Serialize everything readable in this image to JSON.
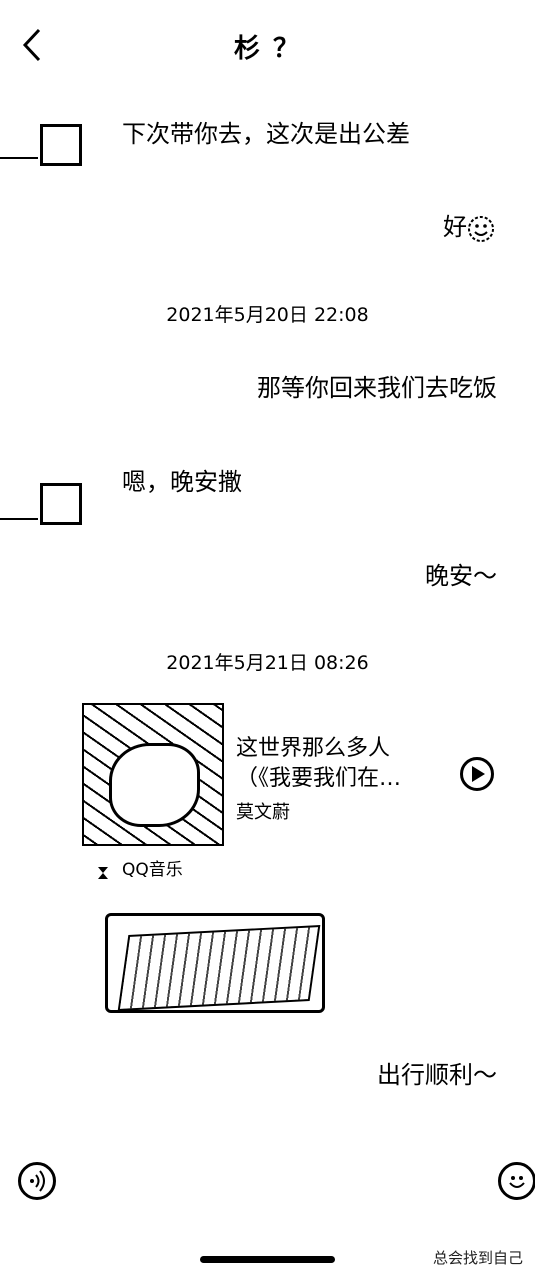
{
  "header": {
    "title": "杉 ？"
  },
  "messages": {
    "m1": "下次带你去，这次是出公差",
    "m2": "好",
    "m3": "那等你回来我们去吃饭",
    "m4": "嗯，晚安撒",
    "m5": "晚安～",
    "m6": "出行顺利～"
  },
  "timestamps": {
    "t1": "2021年5月20日 22:08",
    "t2": "2021年5月21日 08:26"
  },
  "music": {
    "title": "这世界那么多人",
    "subtitle": "（《我要我们在…",
    "artist": "莫文蔚",
    "source": "QQ音乐"
  },
  "footer": {
    "watermark": "总会找到自己"
  }
}
